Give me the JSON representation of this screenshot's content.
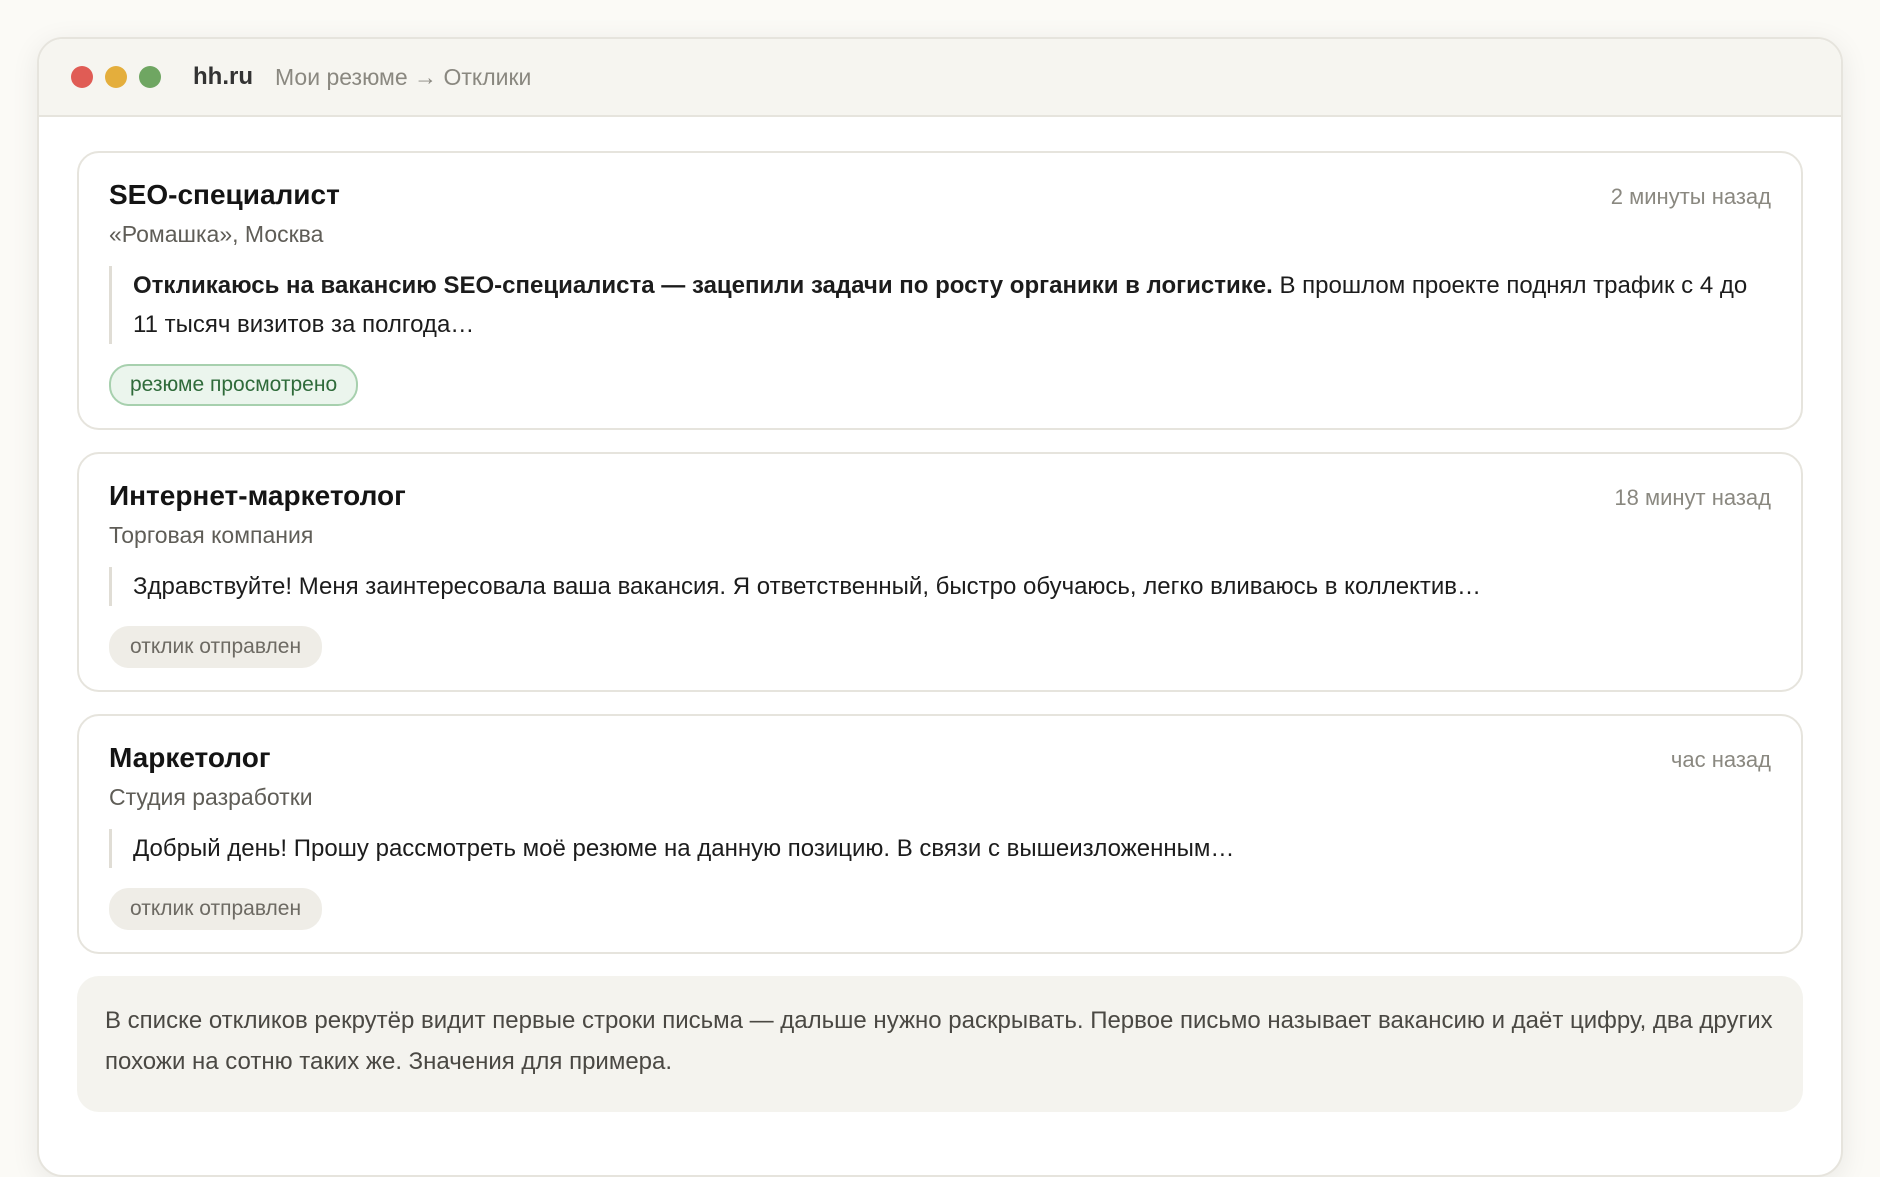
{
  "window": {
    "site": "hh.ru",
    "breadcrumb": "Мои резюме → Отклики"
  },
  "responses": [
    {
      "title": "SEO-специалист",
      "company": "«Ромашка», Москва",
      "time": "2 минуты назад",
      "letter_bold": "Откликаюсь на вакансию SEO-специалиста — зацепили задачи по росту органики в логистике.",
      "letter_rest": " В прошлом проекте поднял трафик с 4 до 11 тысяч визитов за полгода…",
      "status": "резюме просмотрено"
    },
    {
      "title": "Интернет-маркетолог",
      "company": "Торговая компания",
      "time": "18 минут назад",
      "letter_bold": "",
      "letter_rest": "Здравствуйте! Меня заинтересовала ваша вакансия. Я ответственный, быстро обучаюсь, легко вливаюсь в коллектив…",
      "status": "отклик отправлен"
    },
    {
      "title": "Маркетолог",
      "company": "Студия разработки",
      "time": "час назад",
      "letter_bold": "",
      "letter_rest": "Добрый день! Прошу рассмотреть моё резюме на данную позицию. В связи с вышеизложенным…",
      "status": "отклик отправлен"
    }
  ],
  "note": "В списке откликов рекрутёр видит первые строки письма — дальше нужно раскрывать. Первое письмо называет вакансию и даёт цифру, два других похожи на сотню таких же. Значения для примера.",
  "colors": {
    "viewed_badge": "#2f6b3a",
    "sent_badge": "#6d6a63",
    "dot_red": "#e05c55",
    "dot_yellow": "#e4ae3c",
    "dot_green": "#6fa662"
  }
}
